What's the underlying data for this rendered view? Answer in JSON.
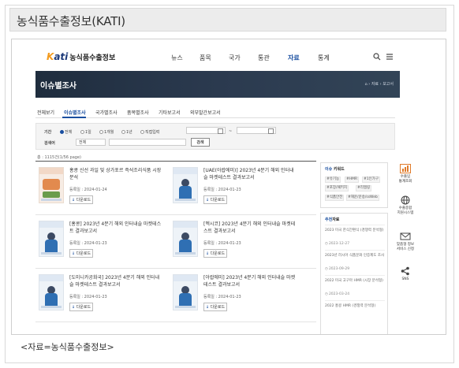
{
  "header": {
    "title": "농식품수출정보(KATI)"
  },
  "site": {
    "logo_mark": "Kati",
    "logo_text": "농식품수출정보",
    "menu": [
      "뉴스",
      "품목",
      "국가",
      "통관",
      "자료",
      "통계"
    ],
    "active_menu": "자료",
    "icons": [
      "search-icon",
      "menu-icon"
    ]
  },
  "banner": {
    "title": "이슈별조사",
    "breadcrumb": "⌂ › 자료 › 보고서"
  },
  "tabs": [
    "전체보기",
    "이슈별조사",
    "국가별조사",
    "품목별조사",
    "기타보고서",
    "외부발간보고서"
  ],
  "active_tab": "이슈별조사",
  "search": {
    "period_label": "기간",
    "period_options": [
      "전체",
      "1일",
      "1개월",
      "1년",
      "직접입력"
    ],
    "period_selected": "전체",
    "date_sep": "~",
    "keyword_label": "검색어",
    "scope_value": "전체",
    "button_label": "검색"
  },
  "total_text": "총 : 1115건(1/56 page)",
  "items": [
    {
      "title": "홍콩 신선 과일 및 상가포르 즉석조리식품 시장 분석",
      "date": "등록일 : 2024-01-24",
      "download": "다운로드",
      "thumb": "food"
    },
    {
      "title": "[UAE(아랍에미)] 2023년 4분기 해외 인터내슬 마켓테스트 결과보고서",
      "date": "등록일 : 2024-01-23",
      "download": "다운로드",
      "thumb": "person"
    },
    {
      "title": "[홍콩] 2023년 4분기 해외 인터내슬 마켓테스트 결과보고서",
      "date": "등록일 : 2024-01-23",
      "download": "다운로드",
      "thumb": "person"
    },
    {
      "title": "[멕시코] 2023년 4분기 해외 인터내슬 마켓테스트 결과보고서",
      "date": "등록일 : 2024-01-23",
      "download": "다운로드",
      "thumb": "person"
    },
    {
      "title": "[도미니카공화국] 2023년 4분기 해외 인터내슬 마켓테스트 결과보고서",
      "date": "등록일 : 2024-01-23",
      "download": "다운로드",
      "thumb": "person"
    },
    {
      "title": "[아랍에미] 2023년 4분기 해외 인터내슬 마켓테스트 결과보고서",
      "date": "등록일 : 2024-01-23",
      "download": "다운로드",
      "thumb": "person"
    }
  ],
  "sidebar": {
    "keyword_title_em": "이슈",
    "keyword_title_rest": " 키워드",
    "tags": [
      "#유기농",
      "#HMR",
      "#1인가구",
      "#포장/패키지",
      "#리멤링",
      "#식품안전",
      "#해운/운송/ssWeb"
    ],
    "recommend_title_em": "추천",
    "recommend_title_rest": "자료",
    "recommend": [
      {
        "title": "2023 미국 한식간편식 (경쟁력 분석형)",
        "date": "2023-12-27"
      },
      {
        "title": "2023년 러시아 식품문화 인증제도 조사",
        "date": "2023-09-29"
      },
      {
        "title": "2022 미국 고구마 HMR (시장 분석형)",
        "date": "2023-03-24"
      },
      {
        "title": "2022 홍콩 HMR (경쟁력 분석형)",
        "date": ""
      }
    ]
  },
  "quick_links": [
    {
      "label": "수출입\n통계조회",
      "icon": "chart-icon"
    },
    {
      "label": "수출종합\n지원시스템",
      "icon": "globe-icon"
    },
    {
      "label": "맞춤형 정보\n서비스 신청",
      "icon": "mail-icon"
    },
    {
      "label": "SNS",
      "icon": "share-icon"
    }
  ],
  "caption": "<자료=농식품수출정보>",
  "colors": {
    "accent": "#1a4fa0",
    "banner": "#2b3a4f",
    "logo_orange": "#f39a1d"
  }
}
